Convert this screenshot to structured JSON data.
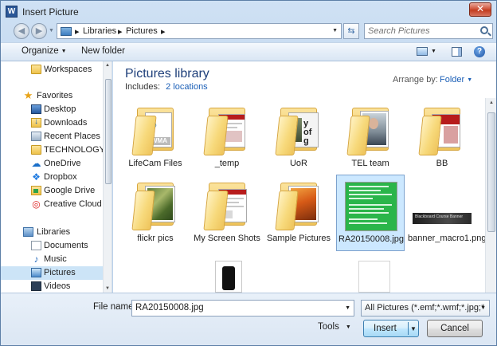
{
  "window": {
    "title": "Insert Picture",
    "app_icon_letter": "W",
    "close_glyph": "✕"
  },
  "address": {
    "segments": [
      "Libraries",
      "Pictures"
    ]
  },
  "search": {
    "placeholder": "Search Pictures"
  },
  "toolbar": {
    "organize_label": "Organize",
    "new_folder_label": "New folder",
    "help_glyph": "?"
  },
  "nav": {
    "items": [
      {
        "label": "Workspaces",
        "icon": "folder-icon"
      },
      {
        "label": "Favorites",
        "icon": "star-icon"
      },
      {
        "label": "Desktop",
        "icon": "desktop-icon"
      },
      {
        "label": "Downloads",
        "icon": "downloads-icon"
      },
      {
        "label": "Recent Places",
        "icon": "recent-places-icon"
      },
      {
        "label": "TECHNOLOGY EI",
        "icon": "folder-icon"
      },
      {
        "label": "OneDrive",
        "icon": "onedrive-icon"
      },
      {
        "label": "Dropbox",
        "icon": "dropbox-icon"
      },
      {
        "label": "Google Drive",
        "icon": "google-drive-icon"
      },
      {
        "label": "Creative Cloud Fi",
        "icon": "creative-cloud-icon"
      },
      {
        "label": "Libraries",
        "icon": "library-icon"
      },
      {
        "label": "Documents",
        "icon": "documents-icon"
      },
      {
        "label": "Music",
        "icon": "music-icon"
      },
      {
        "label": "Pictures",
        "icon": "pictures-icon",
        "selected": true
      },
      {
        "label": "Videos",
        "icon": "videos-icon"
      }
    ]
  },
  "library": {
    "title": "Pictures library",
    "includes_label": "Includes:",
    "includes_link": "2 locations",
    "arrange_label": "Arrange by:",
    "arrange_value": "Folder"
  },
  "files": [
    {
      "name": "LifeCam Files",
      "type": "folder"
    },
    {
      "name": "_temp",
      "type": "folder"
    },
    {
      "name": "UoR",
      "type": "folder"
    },
    {
      "name": "TEL team",
      "type": "folder"
    },
    {
      "name": "BB",
      "type": "folder"
    },
    {
      "name": "flickr pics",
      "type": "folder"
    },
    {
      "name": "My Screen Shots",
      "type": "folder"
    },
    {
      "name": "Sample Pictures",
      "type": "folder"
    },
    {
      "name": "RA20150008.jpg",
      "type": "image",
      "selected": true
    },
    {
      "name": "banner_macro1.png",
      "type": "image"
    }
  ],
  "thumb_text": {
    "wma": "WMA",
    "uor": "y of g",
    "banner": "Blackboard Course Banner"
  },
  "bottom": {
    "file_name_label": "File name:",
    "file_name_value": "RA20150008.jpg",
    "filter_value": "All Pictures (*.emf;*.wmf;*.jpg;*",
    "tools_label": "Tools",
    "insert_label": "Insert",
    "cancel_label": "Cancel"
  },
  "colors": {
    "accent": "#1e3f7a",
    "link": "#1b5fb7",
    "selection": "#cce8ff",
    "green_doc": "#2ab54a"
  }
}
